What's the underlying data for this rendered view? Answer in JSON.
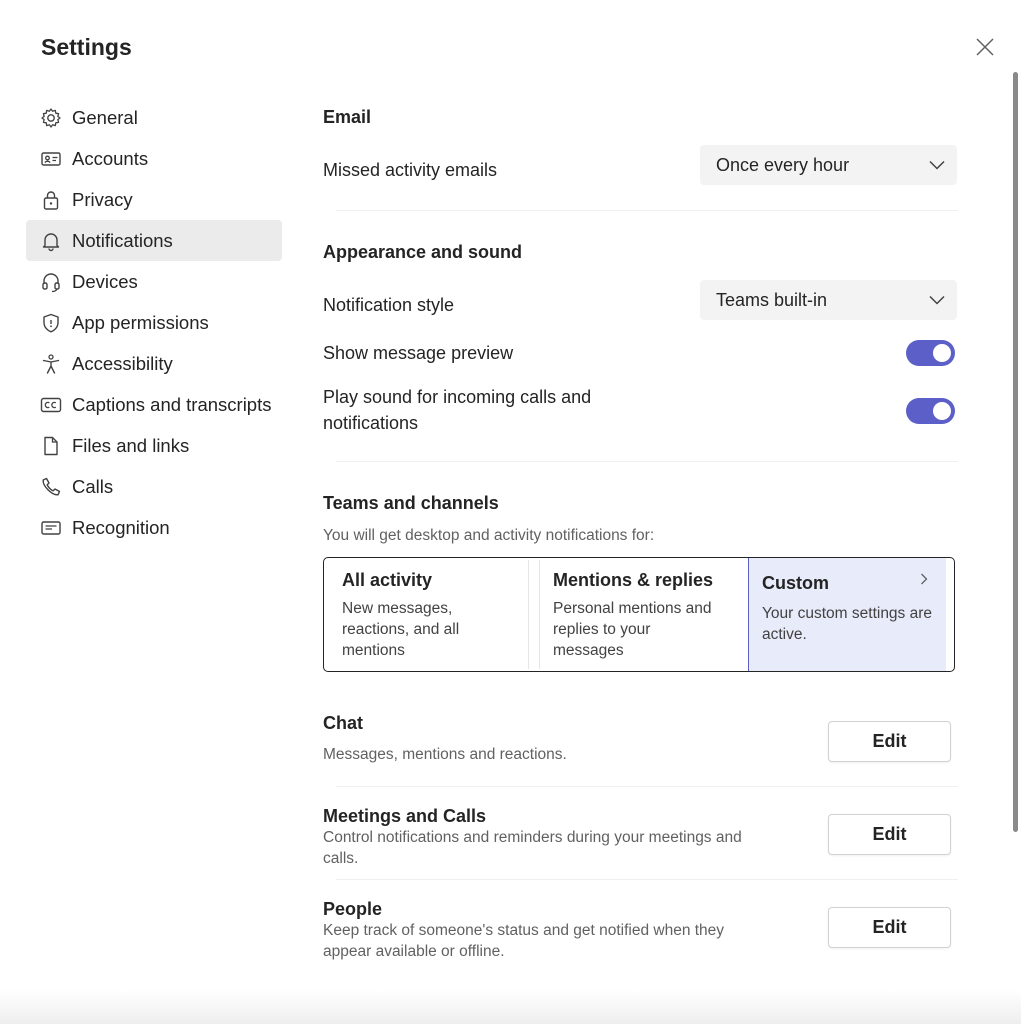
{
  "dialog": {
    "title": "Settings"
  },
  "sidebar": {
    "items": [
      {
        "label": "General",
        "icon": "gear-icon"
      },
      {
        "label": "Accounts",
        "icon": "id-card-icon"
      },
      {
        "label": "Privacy",
        "icon": "lock-icon"
      },
      {
        "label": "Notifications",
        "icon": "bell-icon",
        "active": true
      },
      {
        "label": "Devices",
        "icon": "headset-icon"
      },
      {
        "label": "App permissions",
        "icon": "shield-icon"
      },
      {
        "label": "Accessibility",
        "icon": "accessibility-icon"
      },
      {
        "label": "Captions and transcripts",
        "icon": "closed-captions-icon"
      },
      {
        "label": "Files and links",
        "icon": "document-icon"
      },
      {
        "label": "Calls",
        "icon": "phone-icon"
      },
      {
        "label": "Recognition",
        "icon": "recognition-card-icon"
      }
    ]
  },
  "email": {
    "heading": "Email",
    "missed_label": "Missed activity emails",
    "missed_value": "Once every hour"
  },
  "appearance": {
    "heading": "Appearance and sound",
    "style_label": "Notification style",
    "style_value": "Teams built-in",
    "preview_label": "Show message preview",
    "preview_on": true,
    "sound_label_line1": "Play sound for incoming calls and",
    "sound_label_line2": "notifications",
    "sound_on": true
  },
  "teams": {
    "heading": "Teams and channels",
    "description": "You will get desktop and activity notifications for:",
    "cards": [
      {
        "title": "All activity",
        "desc_lines": [
          "New messages,",
          "reactions, and all",
          "mentions"
        ]
      },
      {
        "title": "Mentions & replies",
        "desc_lines": [
          "Personal mentions and",
          "replies to your messages"
        ]
      },
      {
        "title": "Custom",
        "desc_lines": [
          "Your custom settings are",
          "active."
        ],
        "selected": true
      }
    ]
  },
  "chat": {
    "heading": "Chat",
    "description": "Messages, mentions and reactions.",
    "button": "Edit"
  },
  "meetings": {
    "heading": "Meetings and Calls",
    "description_line1": "Control notifications and reminders during your meetings and",
    "description_line2": "calls.",
    "button": "Edit"
  },
  "people": {
    "heading": "People",
    "description_line1": "Keep track of someone's status and get notified when they",
    "description_line2": "appear available or offline.",
    "button": "Edit"
  },
  "colors": {
    "accent": "#5b5fc7",
    "selected_card_bg": "#e8ebfa",
    "active_nav_bg": "#ebebeb"
  }
}
